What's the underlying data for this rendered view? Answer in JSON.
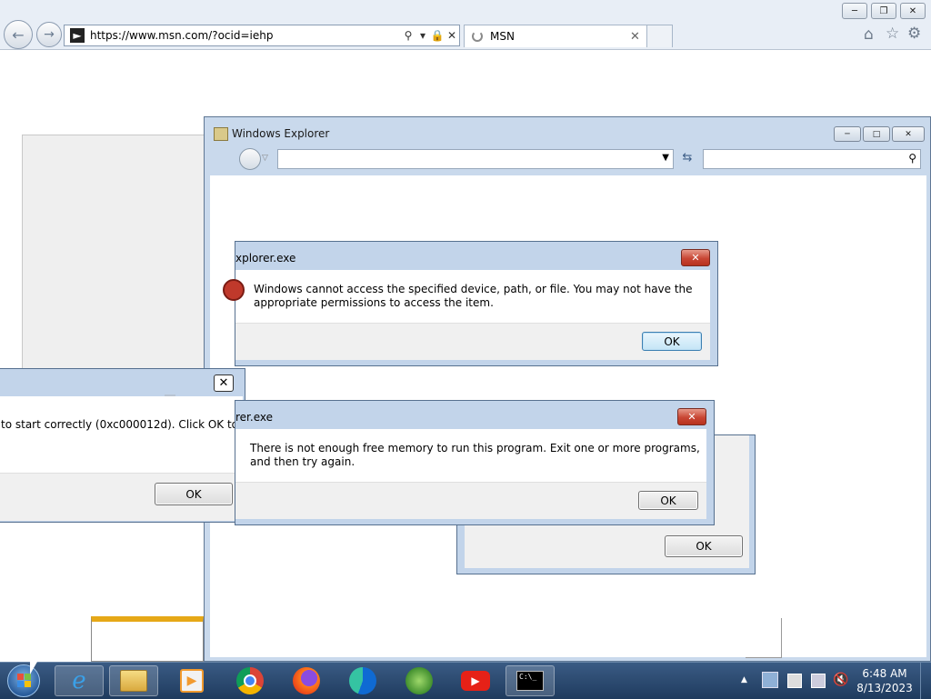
{
  "ie": {
    "url": "https://www.msn.com/?ocid=iehp",
    "tab_title": "MSN",
    "tab_close": "✕",
    "back_icon": "back-arrow-icon",
    "forward_icon": "forward-arrow-icon"
  },
  "explorer": {
    "title": "Windows Explorer"
  },
  "dialog_access": {
    "title": "xplorer.exe",
    "message": "Windows cannot access the specified device, path, or file.  You may not have the appropriate permissions to access the item.",
    "ok": "OK"
  },
  "dialog_memory": {
    "title": "rer.exe",
    "message": "There is not enough free memory to run this program. Exit one or more programs, and then try again.",
    "ok": "OK"
  },
  "dialog_startup": {
    "message": "to start correctly (0xc000012d). Click OK to",
    "ok": "OK"
  },
  "dialog_behind": {
    "ok": "OK"
  },
  "taskbar": {
    "time": "6:48 AM",
    "date": "8/13/2023",
    "cmd_label": "C:\\_"
  },
  "colors": {
    "taskbar": "#1f3b5e",
    "dialog_frame": "#c2d4ea",
    "close_red": "#c84634"
  }
}
